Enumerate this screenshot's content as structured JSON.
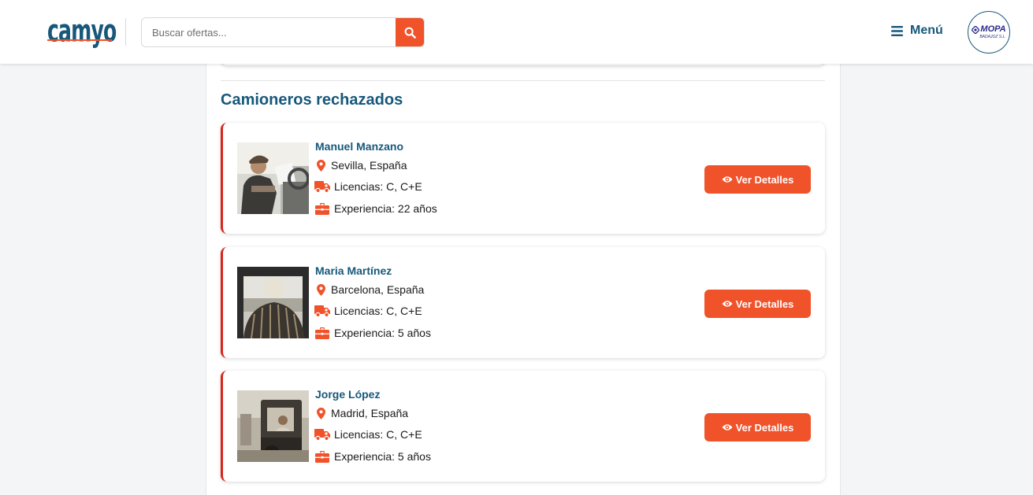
{
  "header": {
    "logo_text": "camyo",
    "search": {
      "placeholder": "Buscar ofertas...",
      "value": ""
    },
    "menu_label": "Menú",
    "company": {
      "name": "MOPA",
      "subtitle": "BADAJOZ S.L."
    }
  },
  "section": {
    "title": "Camioneros rechazados"
  },
  "drivers": [
    {
      "name": "Manuel Manzano",
      "location": "Sevilla, España",
      "licenses": "Licencias: C, C+E",
      "experience": "Experiencia: 22 años",
      "button": "Ver Detalles"
    },
    {
      "name": "Maria Martínez",
      "location": "Barcelona, España",
      "licenses": "Licencias: C, C+E",
      "experience": "Experiencia: 5 años",
      "button": "Ver Detalles"
    },
    {
      "name": "Jorge López",
      "location": "Madrid, España",
      "licenses": "Licencias: C, C+E",
      "experience": "Experiencia: 5 años",
      "button": "Ver Detalles"
    }
  ],
  "colors": {
    "brand_blue": "#17587a",
    "accent_orange": "#f0522a",
    "rejected_red": "#d9241b"
  },
  "icons": [
    "search-icon",
    "hamburger-menu-icon",
    "location-pin-icon",
    "truck-icon",
    "briefcase-icon",
    "eye-icon"
  ]
}
